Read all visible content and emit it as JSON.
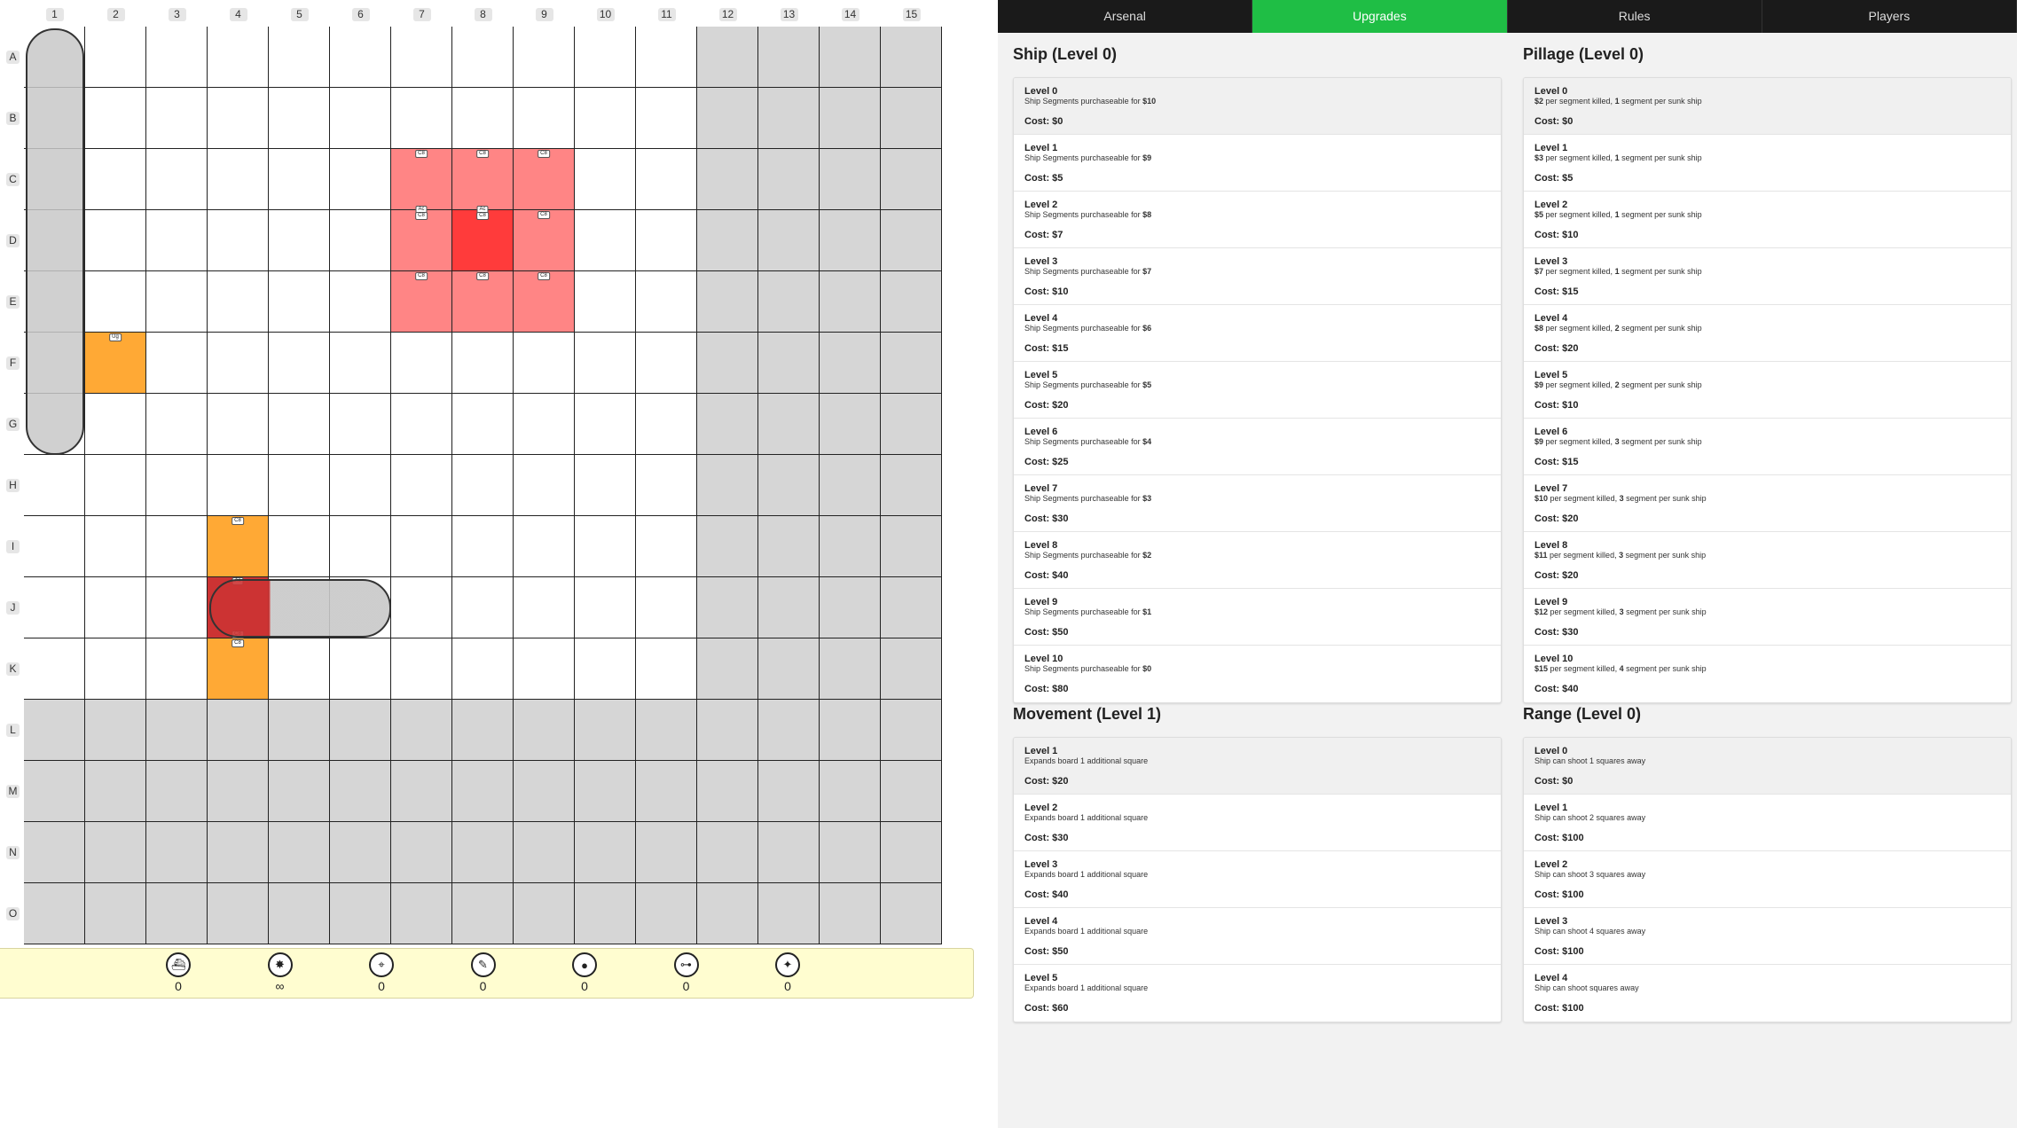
{
  "board": {
    "columns": [
      "1",
      "2",
      "3",
      "4",
      "5",
      "6",
      "7",
      "8",
      "9",
      "10",
      "11",
      "12",
      "13",
      "14",
      "15"
    ],
    "rows": [
      "A",
      "B",
      "C",
      "D",
      "E",
      "F",
      "G",
      "H",
      "I",
      "J",
      "K",
      "L",
      "M",
      "N",
      "O"
    ],
    "unavailable_cells": "columns 12-15 and rows L-O are greyed out",
    "highlights": [
      {
        "cell": "C7",
        "style": "light",
        "marks": [
          "C8"
        ]
      },
      {
        "cell": "C8",
        "style": "light",
        "marks": [
          "C8"
        ]
      },
      {
        "cell": "C9",
        "style": "light",
        "marks": [
          "C8"
        ]
      },
      {
        "cell": "D7",
        "style": "light",
        "marks": [
          "Ac",
          "C8"
        ]
      },
      {
        "cell": "D8",
        "style": "dark",
        "marks": [
          "Ac",
          "C8"
        ]
      },
      {
        "cell": "D9",
        "style": "light",
        "marks": [
          "C8"
        ]
      },
      {
        "cell": "E7",
        "style": "light",
        "marks": [
          "C8"
        ]
      },
      {
        "cell": "E8",
        "style": "light",
        "marks": [
          "C8"
        ]
      },
      {
        "cell": "E9",
        "style": "light",
        "marks": [
          "C8"
        ]
      },
      {
        "cell": "F2",
        "style": "orange",
        "marks": [
          "Ug"
        ]
      },
      {
        "cell": "I4",
        "style": "orange",
        "marks": [
          "C8"
        ]
      },
      {
        "cell": "J4",
        "style": "darkred",
        "marks": [
          "Ac",
          "C8"
        ]
      },
      {
        "cell": "K4",
        "style": "orange",
        "marks": [
          "C8"
        ]
      }
    ],
    "ships": [
      {
        "name": "vertical-ship",
        "cells": "A1-G1"
      },
      {
        "name": "horizontal-ship",
        "cells": "J4-J6"
      }
    ]
  },
  "arsenal": [
    {
      "icon": "ship-segment-icon",
      "count": "0"
    },
    {
      "icon": "scatter-shot-icon",
      "count": "∞"
    },
    {
      "icon": "telescope-icon",
      "count": "0"
    },
    {
      "icon": "torpedo-icon",
      "count": "0"
    },
    {
      "icon": "bomb-icon",
      "count": "0"
    },
    {
      "icon": "sonar-icon",
      "count": "0"
    },
    {
      "icon": "missile-icon",
      "count": "0"
    }
  ],
  "tabs": [
    {
      "label": "Arsenal",
      "active": false
    },
    {
      "label": "Upgrades",
      "active": true
    },
    {
      "label": "Rules",
      "active": false
    },
    {
      "label": "Players",
      "active": false
    }
  ],
  "colors": {
    "tab_active": "#1fbe45",
    "tab_bg": "#1a1a1a",
    "highlight_light": "#ff8585",
    "highlight_dark": "#ff3b3b",
    "orange": "#ffa935",
    "arsenal_bar": "#fffdd0"
  },
  "upgrades": {
    "ship": {
      "title": "Ship (Level 0)",
      "levels": [
        {
          "name": "Level 0",
          "pre": "Ship Segments purchaseable for ",
          "bold": "$10",
          "post": "",
          "cost": "Cost: $0"
        },
        {
          "name": "Level 1",
          "pre": "Ship Segments purchaseable for ",
          "bold": "$9",
          "post": "",
          "cost": "Cost: $5"
        },
        {
          "name": "Level 2",
          "pre": "Ship Segments purchaseable for ",
          "bold": "$8",
          "post": "",
          "cost": "Cost: $7"
        },
        {
          "name": "Level 3",
          "pre": "Ship Segments purchaseable for ",
          "bold": "$7",
          "post": "",
          "cost": "Cost: $10"
        },
        {
          "name": "Level 4",
          "pre": "Ship Segments purchaseable for ",
          "bold": "$6",
          "post": "",
          "cost": "Cost: $15"
        },
        {
          "name": "Level 5",
          "pre": "Ship Segments purchaseable for ",
          "bold": "$5",
          "post": "",
          "cost": "Cost: $20"
        },
        {
          "name": "Level 6",
          "pre": "Ship Segments purchaseable for ",
          "bold": "$4",
          "post": "",
          "cost": "Cost: $25"
        },
        {
          "name": "Level 7",
          "pre": "Ship Segments purchaseable for ",
          "bold": "$3",
          "post": "",
          "cost": "Cost: $30"
        },
        {
          "name": "Level 8",
          "pre": "Ship Segments purchaseable for ",
          "bold": "$2",
          "post": "",
          "cost": "Cost: $40"
        },
        {
          "name": "Level 9",
          "pre": "Ship Segments purchaseable for ",
          "bold": "$1",
          "post": "",
          "cost": "Cost: $50"
        },
        {
          "name": "Level 10",
          "pre": "Ship Segments purchaseable for ",
          "bold": "$0",
          "post": "",
          "cost": "Cost: $80"
        }
      ]
    },
    "pillage": {
      "title": "Pillage (Level 0)",
      "levels": [
        {
          "name": "Level 0",
          "a": "$2",
          "b": "1",
          "cost": "Cost: $0"
        },
        {
          "name": "Level 1",
          "a": "$3",
          "b": "1",
          "cost": "Cost: $5"
        },
        {
          "name": "Level 2",
          "a": "$5",
          "b": "1",
          "cost": "Cost: $10"
        },
        {
          "name": "Level 3",
          "a": "$7",
          "b": "1",
          "cost": "Cost: $15"
        },
        {
          "name": "Level 4",
          "a": "$8",
          "b": "2",
          "cost": "Cost: $20"
        },
        {
          "name": "Level 5",
          "a": "$9",
          "b": "2",
          "cost": "Cost: $10"
        },
        {
          "name": "Level 6",
          "a": "$9",
          "b": "3",
          "cost": "Cost: $15"
        },
        {
          "name": "Level 7",
          "a": "$10",
          "b": "3",
          "cost": "Cost: $20"
        },
        {
          "name": "Level 8",
          "a": "$11",
          "b": "3",
          "cost": "Cost: $20"
        },
        {
          "name": "Level 9",
          "a": "$12",
          "b": "3",
          "cost": "Cost: $30"
        },
        {
          "name": "Level 10",
          "a": "$15",
          "b": "4",
          "cost": "Cost: $40"
        }
      ],
      "mid_text": " per segment killed, ",
      "end_text": " segment per sunk ship"
    },
    "movement": {
      "title": "Movement (Level 1)",
      "levels": [
        {
          "name": "Level 1",
          "desc": "Expands board 1 additional square",
          "cost": "Cost: $20"
        },
        {
          "name": "Level 2",
          "desc": "Expands board 1 additional square",
          "cost": "Cost: $30"
        },
        {
          "name": "Level 3",
          "desc": "Expands board 1 additional square",
          "cost": "Cost: $40"
        },
        {
          "name": "Level 4",
          "desc": "Expands board 1 additional square",
          "cost": "Cost: $50"
        },
        {
          "name": "Level 5",
          "desc": "Expands board 1 additional square",
          "cost": "Cost: $60"
        }
      ]
    },
    "range": {
      "title": "Range (Level 0)",
      "levels": [
        {
          "name": "Level 0",
          "desc": "Ship can shoot 1 squares away",
          "cost": "Cost: $0"
        },
        {
          "name": "Level 1",
          "desc": "Ship can shoot 2 squares away",
          "cost": "Cost: $100"
        },
        {
          "name": "Level 2",
          "desc": "Ship can shoot 3 squares away",
          "cost": "Cost: $100"
        },
        {
          "name": "Level 3",
          "desc": "Ship can shoot 4 squares away",
          "cost": "Cost: $100"
        },
        {
          "name": "Level 4",
          "desc": "Ship can shoot squares away",
          "cost": "Cost: $100"
        }
      ]
    }
  }
}
